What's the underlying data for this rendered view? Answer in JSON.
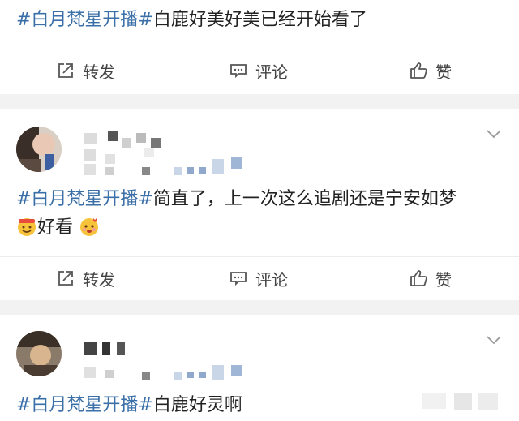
{
  "posts": [
    {
      "topic": "#白月梵星开播#",
      "text": "白鹿好美好美已经开始看了",
      "actions": {
        "repost": "转发",
        "comment": "评论",
        "like": "赞"
      }
    },
    {
      "topic": "#白月梵星开播#",
      "text": "简直了，上一次这么追剧还是宁安如梦",
      "text2": "好看",
      "actions": {
        "repost": "转发",
        "comment": "评论",
        "like": "赞"
      }
    },
    {
      "topic": "#白月梵星开播#",
      "text": "白鹿好灵啊"
    }
  ],
  "colors": {
    "topic": "#3a6fa7",
    "action_text": "#444444",
    "separator": "#f2f2f2"
  },
  "icons": [
    "repost-icon",
    "comment-icon",
    "like-icon",
    "chevron-down-icon",
    "avatar",
    "emoji-icon"
  ]
}
